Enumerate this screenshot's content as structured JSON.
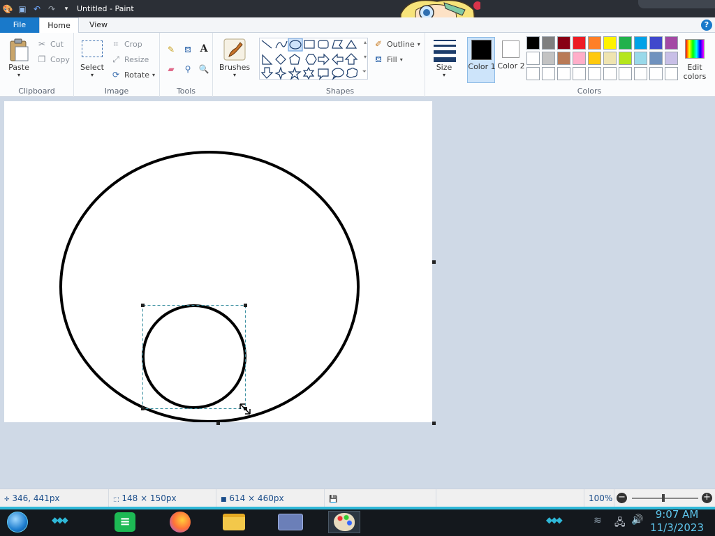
{
  "window": {
    "title": "Untitled - Paint"
  },
  "tabs": {
    "file": "File",
    "home": "Home",
    "view": "View",
    "help": "?"
  },
  "clipboard": {
    "paste": "Paste",
    "cut": "Cut",
    "copy": "Copy",
    "label": "Clipboard"
  },
  "image": {
    "select": "Select",
    "crop": "Crop",
    "resize": "Resize",
    "rotate": "Rotate",
    "label": "Image"
  },
  "tools": {
    "label": "Tools"
  },
  "brushes": {
    "label": "Brushes"
  },
  "shapes": {
    "outline": "Outline",
    "fill": "Fill",
    "label": "Shapes"
  },
  "size": {
    "label": "Size"
  },
  "colors": {
    "color1_label": "Color 1",
    "color2_label": "Color 2",
    "edit_label": "Edit colors",
    "label": "Colors",
    "color1": "#000000",
    "color2": "#ffffff",
    "palette_row1": [
      "#000000",
      "#7f7f7f",
      "#880015",
      "#ed1c24",
      "#ff7f27",
      "#fff200",
      "#22b14c",
      "#00a2e8",
      "#3f48cc",
      "#a349a4"
    ],
    "palette_row2": [
      "#ffffff",
      "#c3c3c3",
      "#b97a57",
      "#ffaec9",
      "#ffc90e",
      "#efe4b0",
      "#b5e61d",
      "#99d9ea",
      "#7092be",
      "#c8bfe7"
    ]
  },
  "status": {
    "cursor_pos": "346, 441px",
    "selection_size": "148 × 150px",
    "canvas_size": "614 × 460px",
    "zoom": "100%"
  },
  "taskbar": {
    "time": "9:07 AM",
    "date": "11/3/2023"
  }
}
